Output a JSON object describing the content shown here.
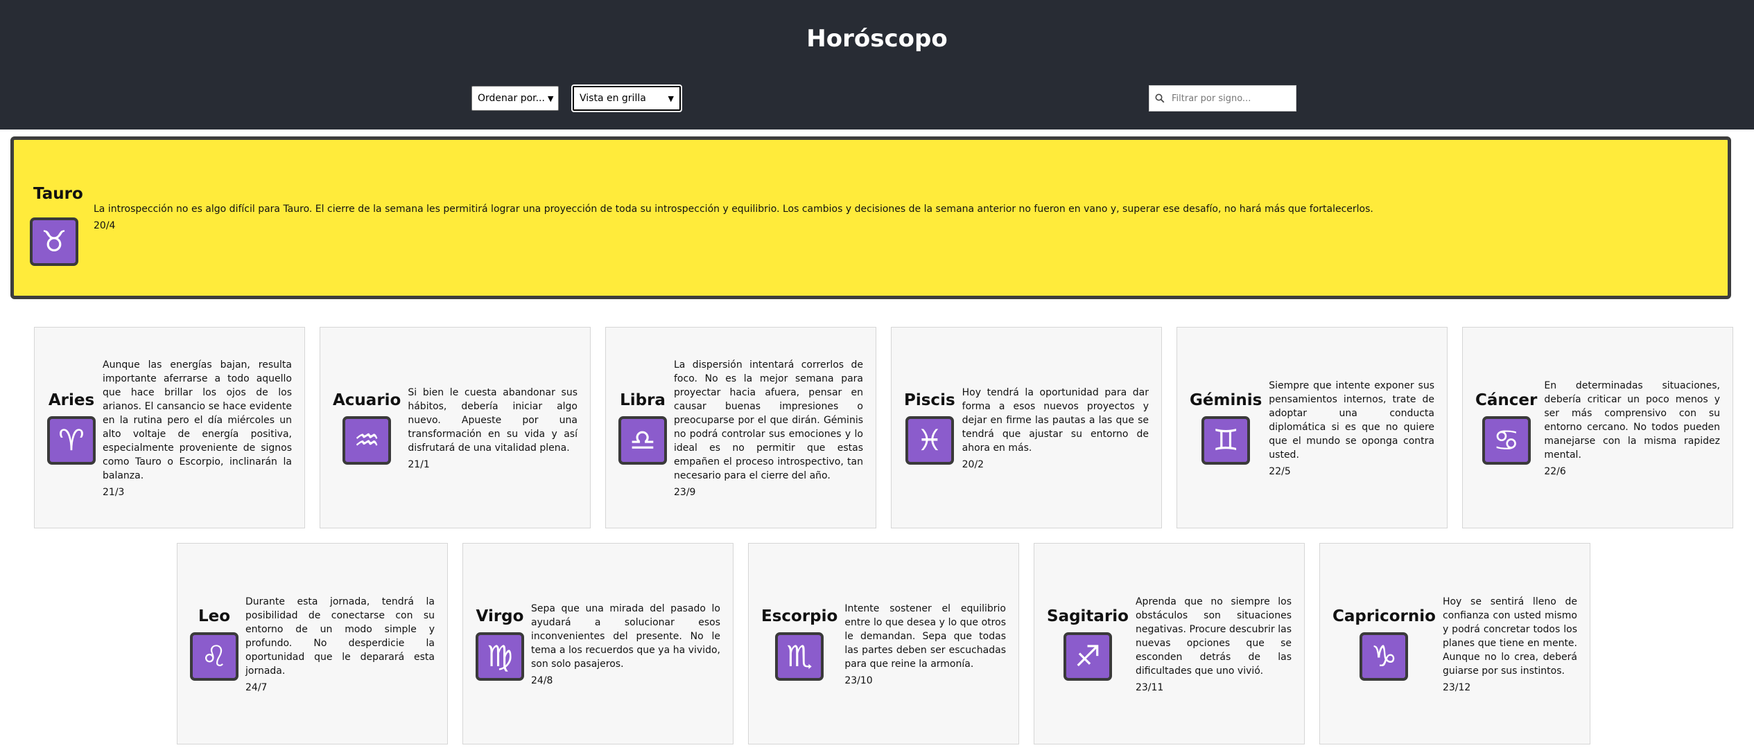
{
  "app": {
    "title": "Horóscopo",
    "sort_select_label": "Ordenar por...",
    "view_select_label": "Vista en grilla",
    "search_placeholder": "Filtrar por signo..."
  },
  "featured": {
    "name": "Tauro",
    "symbol": "♉",
    "description": "La introspección no es algo difícil para Tauro. El cierre de la semana les permitirá lograr una proyección de toda su introspección y equilibrio. Los cambios y decisiones de la semana anterior no fueron en vano y, superar ese desafío, no hará más que fortalecerlos.",
    "date": "20/4"
  },
  "signs": [
    {
      "name": "Aries",
      "symbol": "♈",
      "description": "Aunque las energías bajan, resulta importante aferrarse a todo aquello que hace brillar los ojos de los arianos. El cansancio se hace evidente en la rutina pero el día miércoles un alto voltaje de energía positiva, especialmente proveniente de signos como Tauro o Escorpio, inclinarán la balanza.",
      "date": "21/3"
    },
    {
      "name": "Acuario",
      "symbol": "♒",
      "description": "Si bien le cuesta abandonar sus hábitos, debería iniciar algo nuevo. Apueste por una transformación en su vida y así disfrutará de una vitalidad plena.",
      "date": "21/1"
    },
    {
      "name": "Libra",
      "symbol": "♎",
      "description": "La dispersión intentará correrlos de foco. No es la mejor semana para proyectar hacia afuera, pensar en causar buenas impresiones o preocuparse por el que dirán. Géminis no podrá controlar sus emociones y lo ideal es no permitir que estas empañen el proceso introspectivo, tan necesario para el cierre del año.",
      "date": "23/9"
    },
    {
      "name": "Piscis",
      "symbol": "♓",
      "description": "Hoy tendrá la oportunidad para dar forma a esos nuevos proyectos y dejar en firme las pautas a las que se tendrá que ajustar su entorno de ahora en más.",
      "date": "20/2"
    },
    {
      "name": "Géminis",
      "symbol": "♊",
      "description": "Siempre que intente exponer sus pensamientos internos, trate de adoptar una conducta diplomática si es que no quiere que el mundo se oponga contra usted.",
      "date": "22/5"
    },
    {
      "name": "Cáncer",
      "symbol": "♋",
      "description": "En determinadas situaciones, debería criticar un poco menos y ser más comprensivo con su entorno cercano. No todos pueden manejarse con la misma rapidez mental.",
      "date": "22/6"
    },
    {
      "name": "Leo",
      "symbol": "♌",
      "description": "Durante esta jornada, tendrá la posibilidad de conectarse con su entorno de un modo simple y profundo. No desperdicie la oportunidad que le deparará esta jornada.",
      "date": "24/7"
    },
    {
      "name": "Virgo",
      "symbol": "♍",
      "description": "Sepa que una mirada del pasado lo ayudará a solucionar esos inconvenientes del presente. No le tema a los recuerdos que ya ha vivido, son solo pasajeros.",
      "date": "24/8"
    },
    {
      "name": "Escorpio",
      "symbol": "♏",
      "description": "Intente sostener el equilibrio entre lo que desea y lo que otros le demandan. Sepa que todas las partes deben ser escuchadas para que reine la armonía.",
      "date": "23/10"
    },
    {
      "name": "Sagitario",
      "symbol": "♐",
      "description": "Aprenda que no siempre los obstáculos son situaciones negativas. Procure descubrir las nuevas opciones que se esconden detrás de las dificultades que uno vivió.",
      "date": "23/11"
    },
    {
      "name": "Capricornio",
      "symbol": "♑",
      "description": "Hoy se sentirá lleno de confianza con usted mismo y podrá concretar todos los planes que tiene en mente. Aunque no lo crea, deberá guiarse por sus instintos.",
      "date": "23/12"
    }
  ],
  "colors": {
    "header_bg": "#282c34",
    "featured_bg": "#ffeb3b",
    "icon_bg": "#8b5ccc",
    "card_bg": "#f7f7f7"
  }
}
